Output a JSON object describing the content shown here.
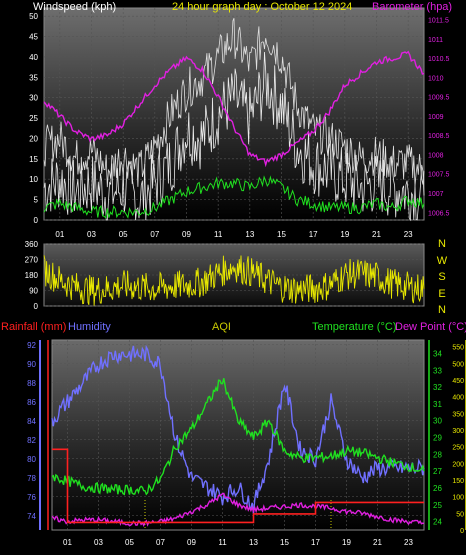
{
  "header": {
    "left_label": "Windspeed (kph)",
    "title": "24 hour graph day : October 12 2024",
    "right_label": "Barometer (hpa)",
    "colors": {
      "left": "#ffffff",
      "title": "#e8e800",
      "right": "#e020e0"
    }
  },
  "direction": {
    "letters": [
      "N",
      "W",
      "S",
      "E",
      "N"
    ],
    "color": "#e8e800"
  },
  "lower_header": {
    "rain_label": "Rainfall (mm)",
    "humidity_label": "Humidity",
    "aqi_label": "AQI",
    "temp_label": "Temperature (°C)",
    "dew_label": "Dew Point (°C)",
    "colors": {
      "rain": "#ff2020",
      "humidity": "#7070ff",
      "aqi": "#c8c800",
      "temp": "#20e020",
      "dew": "#e020e0"
    }
  },
  "chart_data": [
    {
      "type": "line",
      "id": "wind-baro",
      "x_ticks": [
        "01",
        "03",
        "05",
        "07",
        "09",
        "11",
        "13",
        "15",
        "17",
        "19",
        "21",
        "23"
      ],
      "y_left_ticks": [
        0,
        5,
        10,
        15,
        20,
        25,
        30,
        35,
        40,
        45,
        50
      ],
      "ylim_left": [
        0,
        52
      ],
      "y_right_ticks": [
        "1006.5",
        "1007",
        "1007.5",
        "1008",
        "1008.5",
        "1009",
        "1009.5",
        "1010",
        "1010.5",
        "1011",
        "1011.5"
      ],
      "ylim_right": [
        1006.3,
        1011.8
      ],
      "series": [
        {
          "name": "Windspeed (kph)",
          "color": "#ffffff",
          "axis": "left",
          "x": [
            0,
            1,
            2,
            3,
            4,
            5,
            6,
            7,
            8,
            9,
            10,
            11,
            12,
            13,
            14,
            15,
            16,
            17,
            18,
            19,
            20,
            21,
            22,
            23,
            24
          ],
          "values": [
            8,
            10,
            7,
            9,
            6,
            8,
            5,
            9,
            14,
            22,
            20,
            26,
            30,
            25,
            34,
            28,
            18,
            14,
            12,
            10,
            8,
            9,
            8,
            7,
            6
          ]
        },
        {
          "name": "Wind gust",
          "color": "#e0e0e0",
          "axis": "left",
          "x": [
            0,
            1,
            2,
            3,
            4,
            5,
            6,
            7,
            8,
            9,
            10,
            11,
            12,
            13,
            14,
            15,
            16,
            17,
            18,
            19,
            20,
            21,
            22,
            23,
            24
          ],
          "values": [
            18,
            20,
            15,
            17,
            12,
            16,
            12,
            18,
            26,
            32,
            35,
            40,
            45,
            38,
            46,
            40,
            28,
            22,
            20,
            18,
            15,
            16,
            14,
            14,
            12
          ]
        },
        {
          "name": "Wind average",
          "color": "#20e020",
          "axis": "left",
          "x": [
            0,
            1,
            2,
            3,
            4,
            5,
            6,
            7,
            8,
            9,
            10,
            11,
            12,
            13,
            14,
            15,
            16,
            17,
            18,
            19,
            20,
            21,
            22,
            23,
            24
          ],
          "values": [
            3,
            4,
            3,
            2,
            2,
            2,
            2,
            3,
            5,
            7,
            8,
            9,
            9,
            8,
            10,
            8,
            5,
            4,
            3,
            3,
            3,
            4,
            3,
            5,
            4
          ]
        },
        {
          "name": "Barometer (hpa)",
          "color": "#e020e0",
          "axis": "right",
          "x": [
            0,
            1,
            2,
            3,
            4,
            5,
            6,
            7,
            8,
            9,
            10,
            11,
            12,
            13,
            14,
            15,
            16,
            17,
            18,
            19,
            20,
            21,
            22,
            23,
            24
          ],
          "values": [
            1009.4,
            1009.0,
            1008.6,
            1008.4,
            1008.5,
            1008.8,
            1009.3,
            1009.8,
            1010.2,
            1010.5,
            1010.2,
            1009.5,
            1008.7,
            1008.0,
            1007.8,
            1008.0,
            1008.3,
            1008.6,
            1009.1,
            1009.8,
            1010.1,
            1010.4,
            1010.5,
            1010.6,
            1010.1
          ]
        }
      ]
    },
    {
      "type": "line",
      "id": "wind-direction",
      "y_ticks": [
        0,
        90,
        180,
        270,
        360
      ],
      "ylim": [
        0,
        360
      ],
      "series": [
        {
          "name": "Wind direction",
          "color": "#e8e800",
          "x": [
            0,
            1,
            2,
            3,
            4,
            5,
            6,
            7,
            8,
            9,
            10,
            11,
            12,
            13,
            14,
            15,
            16,
            17,
            18,
            19,
            20,
            21,
            22,
            23,
            24
          ],
          "values": [
            210,
            150,
            110,
            90,
            100,
            120,
            110,
            100,
            115,
            120,
            140,
            190,
            230,
            200,
            150,
            110,
            95,
            100,
            120,
            180,
            190,
            170,
            130,
            110,
            100
          ]
        }
      ]
    },
    {
      "type": "line",
      "id": "temp-hum-rain",
      "x_ticks": [
        "01",
        "03",
        "05",
        "07",
        "09",
        "11",
        "13",
        "15",
        "17",
        "19",
        "21",
        "23"
      ],
      "y_humidity_ticks": [
        74,
        76,
        78,
        80,
        82,
        84,
        86,
        88,
        90,
        92
      ],
      "ylim_humidity": [
        72.5,
        92.5
      ],
      "y_temp_ticks": [
        24,
        25,
        26,
        27,
        28,
        29,
        30,
        31,
        32,
        33,
        34
      ],
      "ylim_temp": [
        23.5,
        34.8
      ],
      "y_aqi_ticks": [
        0,
        50,
        100,
        150,
        200,
        250,
        300,
        350,
        400,
        450,
        500,
        550
      ],
      "ylim_aqi": [
        0,
        570
      ],
      "series": [
        {
          "name": "Humidity",
          "color": "#7070ff",
          "axis": "humidity",
          "x": [
            0,
            1,
            2,
            3,
            4,
            5,
            6,
            7,
            8,
            9,
            10,
            11,
            12,
            13,
            14,
            15,
            16,
            17,
            18,
            19,
            20,
            21,
            22,
            23,
            24
          ],
          "values": [
            84,
            86,
            88,
            90,
            91,
            91,
            91,
            90,
            82,
            78,
            77,
            76,
            77,
            75,
            80,
            88,
            81,
            80,
            86,
            80,
            78,
            79,
            79,
            79,
            79
          ]
        },
        {
          "name": "Temperature (°C)",
          "color": "#20e020",
          "axis": "temp",
          "x": [
            0,
            1,
            2,
            3,
            4,
            5,
            6,
            7,
            8,
            9,
            10,
            11,
            12,
            13,
            14,
            15,
            16,
            17,
            18,
            19,
            20,
            21,
            22,
            23,
            24
          ],
          "values": [
            26.7,
            26.4,
            26.1,
            26.0,
            25.9,
            25.9,
            25.8,
            26.5,
            28.5,
            29.5,
            31.0,
            32.5,
            30.0,
            29.0,
            30.0,
            28.2,
            27.8,
            27.8,
            27.9,
            28.2,
            28.1,
            27.8,
            27.5,
            27.3,
            27.0
          ]
        },
        {
          "name": "Dew Point (°C)",
          "color": "#e020e0",
          "axis": "temp",
          "x": [
            0,
            1,
            2,
            3,
            4,
            5,
            6,
            7,
            8,
            9,
            10,
            11,
            12,
            13,
            14,
            15,
            16,
            17,
            18,
            19,
            20,
            21,
            22,
            23,
            24
          ],
          "values": [
            24.2,
            24.0,
            24.1,
            24.1,
            24.0,
            23.9,
            23.9,
            24.0,
            24.2,
            24.6,
            25.0,
            25.6,
            25.0,
            24.7,
            24.8,
            24.9,
            25.0,
            24.9,
            24.8,
            24.6,
            24.5,
            24.3,
            24.1,
            24.0,
            23.9
          ]
        },
        {
          "name": "Rainfall (mm)",
          "color": "#ff2020",
          "axis": "humidity",
          "x": [
            0,
            0.6,
            1,
            6,
            12,
            13,
            14,
            16,
            17,
            18,
            19,
            20,
            21,
            22,
            23,
            24
          ],
          "values": [
            81,
            81,
            73.3,
            73.3,
            73.3,
            74.2,
            74.2,
            74.2,
            75.4,
            75.4,
            75.4,
            75.4,
            75.4,
            75.4,
            75.4,
            75.4
          ]
        },
        {
          "name": "AQI",
          "color": "#c8c800",
          "axis": "aqi",
          "x": [
            0,
            6,
            7,
            8,
            9,
            10,
            11,
            12,
            13,
            14,
            15,
            16,
            17,
            18,
            19,
            20,
            21,
            22,
            23,
            24
          ],
          "values": [
            0,
            0,
            0,
            0,
            0,
            0,
            0,
            0,
            0,
            0,
            0,
            0,
            0,
            0,
            0,
            0,
            0,
            0,
            0,
            0
          ]
        }
      ]
    }
  ]
}
